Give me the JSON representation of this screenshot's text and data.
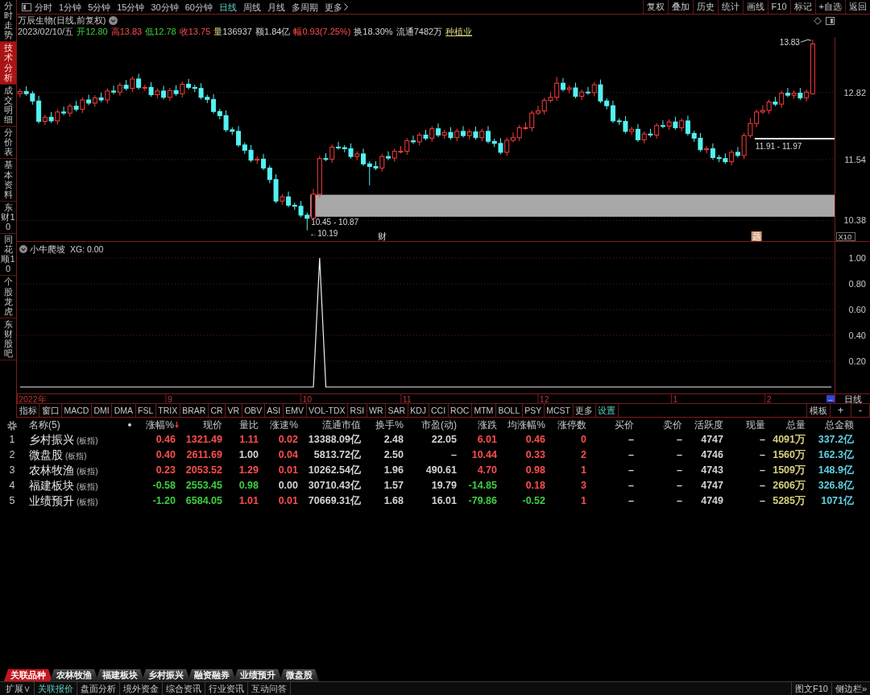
{
  "sidebar": {
    "items": [
      {
        "label": "分时走势",
        "selected": false
      },
      {
        "label": "技术分析",
        "selected": true
      },
      {
        "label": "成交明细",
        "selected": false
      },
      {
        "label": "分价表",
        "selected": false
      },
      {
        "label": "基本资料",
        "selected": false
      },
      {
        "label": "东财10",
        "selected": false
      },
      {
        "label": "同花顺10",
        "selected": false
      },
      {
        "label": "个股龙虎",
        "selected": false
      },
      {
        "label": "东财股吧",
        "selected": false
      }
    ]
  },
  "toolbar": {
    "periods": [
      {
        "label": "分时",
        "selected": false
      },
      {
        "label": "1分钟",
        "selected": false
      },
      {
        "label": "5分钟",
        "selected": false
      },
      {
        "label": "15分钟",
        "selected": false
      },
      {
        "label": "30分钟",
        "selected": false
      },
      {
        "label": "60分钟",
        "selected": false
      },
      {
        "label": "日线",
        "selected": true
      },
      {
        "label": "周线",
        "selected": false
      },
      {
        "label": "月线",
        "selected": false
      },
      {
        "label": "多周期",
        "selected": false
      }
    ],
    "more": "更多",
    "buttons": [
      "复权",
      "叠加",
      "历史",
      "统计",
      "画线",
      "F10",
      "标记",
      "+自选",
      "返回"
    ]
  },
  "quote_header": {
    "title": "万辰生物(日线,前复权)",
    "date": "2023/02/10/五",
    "fields": [
      {
        "label": "开",
        "value": "12.80",
        "color": "#3fcf3f",
        "label_highlight": false
      },
      {
        "label": "高",
        "value": "13.83",
        "color": "#ff4d4d",
        "label_highlight": false
      },
      {
        "label": "低",
        "value": "12.78",
        "color": "#3fcf3f",
        "label_highlight": false
      },
      {
        "label": "收",
        "value": "13.75",
        "color": "#ff4d4d",
        "label_highlight": false
      },
      {
        "label": "量",
        "value": "136937",
        "color": "#d4d4d4",
        "label_highlight": true
      },
      {
        "label": "额",
        "value": "1.84亿",
        "color": "#d4d4d4",
        "label_highlight": false
      },
      {
        "label": "幅",
        "value": "0.93(7.25%)",
        "color": "#ff4d4d",
        "label_highlight": false
      },
      {
        "label": "换",
        "value": "18.30%",
        "color": "#d4d4d4",
        "label_highlight": false
      },
      {
        "label": "流通",
        "value": "7482万",
        "color": "#d4d4d4",
        "label_highlight": false
      }
    ],
    "industry": "种植业"
  },
  "price_chart": {
    "chart_data": {
      "type": "candlestick",
      "categories": [
        null,
        null,
        null,
        null,
        null,
        null,
        null,
        null,
        null,
        null,
        null,
        null,
        null,
        null,
        null,
        null,
        null,
        null,
        null,
        null,
        null,
        null,
        null,
        null,
        null,
        null,
        null,
        null,
        null,
        null,
        null,
        null,
        null,
        null,
        null,
        null,
        null,
        null,
        null,
        null,
        null,
        null,
        null,
        null,
        null,
        null,
        null,
        null,
        null,
        null,
        null,
        null,
        null,
        null,
        null,
        null,
        null,
        null,
        null,
        null,
        null,
        null,
        null,
        null,
        null,
        null,
        null,
        null,
        null,
        null,
        null,
        null,
        null,
        null,
        null,
        null,
        null,
        null,
        null,
        null,
        null,
        null,
        null,
        null,
        null,
        null,
        null,
        null,
        null,
        null,
        null,
        null,
        null,
        null,
        null,
        null,
        null,
        null,
        null,
        null,
        null,
        null,
        null,
        null,
        null,
        null,
        null,
        null,
        null,
        null,
        null,
        null,
        null,
        null,
        null,
        null,
        null,
        null,
        null,
        null,
        null,
        null,
        null,
        null,
        null,
        null,
        null,
        null,
        null,
        null,
        null
      ],
      "ohlc": [
        [
          12.8,
          12.89,
          12.73,
          12.84
        ],
        [
          12.84,
          12.94,
          12.76,
          12.8
        ],
        [
          12.8,
          12.85,
          12.59,
          12.66
        ],
        [
          12.66,
          12.76,
          12.23,
          12.27
        ],
        [
          12.27,
          12.4,
          12.2,
          12.35
        ],
        [
          12.35,
          12.45,
          12.24,
          12.28
        ],
        [
          12.28,
          12.5,
          12.21,
          12.45
        ],
        [
          12.45,
          12.55,
          12.39,
          12.43
        ],
        [
          12.43,
          12.61,
          12.36,
          12.56
        ],
        [
          12.56,
          12.66,
          12.46,
          12.5
        ],
        [
          12.5,
          12.73,
          12.43,
          12.68
        ],
        [
          12.68,
          12.78,
          12.58,
          12.62
        ],
        [
          12.62,
          12.77,
          12.55,
          12.72
        ],
        [
          12.72,
          12.82,
          12.64,
          12.68
        ],
        [
          12.68,
          12.9,
          12.61,
          12.85
        ],
        [
          12.85,
          12.95,
          12.79,
          12.83
        ],
        [
          12.83,
          13.01,
          12.76,
          12.96
        ],
        [
          12.96,
          13.06,
          12.86,
          12.9
        ],
        [
          12.9,
          13.13,
          12.83,
          13.08
        ],
        [
          13.08,
          13.18,
          12.88,
          12.92
        ],
        [
          12.92,
          12.97,
          12.85,
          12.92
        ],
        [
          12.92,
          13.02,
          12.74,
          12.78
        ],
        [
          12.78,
          12.9,
          12.71,
          12.85
        ],
        [
          12.85,
          12.95,
          12.69,
          12.73
        ],
        [
          12.73,
          12.91,
          12.66,
          12.86
        ],
        [
          12.86,
          12.96,
          12.76,
          12.8
        ],
        [
          12.8,
          13.03,
          12.73,
          12.98
        ],
        [
          12.98,
          13.08,
          12.88,
          12.92
        ],
        [
          12.92,
          12.97,
          12.83,
          12.9
        ],
        [
          12.9,
          13.0,
          12.69,
          12.73
        ],
        [
          12.73,
          12.78,
          12.62,
          12.69
        ],
        [
          12.69,
          12.79,
          12.42,
          12.46
        ],
        [
          12.46,
          12.51,
          12.31,
          12.38
        ],
        [
          12.38,
          12.48,
          12.07,
          12.11
        ],
        [
          12.11,
          12.16,
          12.01,
          12.08
        ],
        [
          12.08,
          12.18,
          11.78,
          11.82
        ],
        [
          11.82,
          11.87,
          11.65,
          11.72
        ],
        [
          11.72,
          11.82,
          11.49,
          11.53
        ],
        [
          11.53,
          11.6,
          11.46,
          11.55
        ],
        [
          11.55,
          11.65,
          11.34,
          11.38
        ],
        [
          11.38,
          11.43,
          11.09,
          11.16
        ],
        [
          11.16,
          11.26,
          10.71,
          10.75
        ],
        [
          10.75,
          10.88,
          10.68,
          10.83
        ],
        [
          10.83,
          10.93,
          10.63,
          10.67
        ],
        [
          10.67,
          10.72,
          10.58,
          10.65
        ],
        [
          10.65,
          10.75,
          10.44,
          10.48
        ],
        [
          10.48,
          10.53,
          10.19,
          10.42
        ],
        [
          10.42,
          10.98,
          10.38,
          10.88
        ],
        [
          10.88,
          11.61,
          10.81,
          11.56
        ],
        [
          11.56,
          11.66,
          11.51,
          11.55
        ],
        [
          11.55,
          11.83,
          11.48,
          11.78
        ],
        [
          11.78,
          11.88,
          11.73,
          11.77
        ],
        [
          11.77,
          11.82,
          11.68,
          11.75
        ],
        [
          11.75,
          11.85,
          11.56,
          11.6
        ],
        [
          11.6,
          11.7,
          11.53,
          11.65
        ],
        [
          11.65,
          11.75,
          11.42,
          11.46
        ],
        [
          11.46,
          11.51,
          11.05,
          11.41
        ],
        [
          11.41,
          11.51,
          11.34,
          11.38
        ],
        [
          11.38,
          11.65,
          11.31,
          11.6
        ],
        [
          11.6,
          11.7,
          11.53,
          11.57
        ],
        [
          11.57,
          11.75,
          11.5,
          11.7
        ],
        [
          11.7,
          11.8,
          11.66,
          11.7
        ],
        [
          11.7,
          11.95,
          11.63,
          11.9
        ],
        [
          11.9,
          12.0,
          11.84,
          11.88
        ],
        [
          11.88,
          12.06,
          11.81,
          12.01
        ],
        [
          12.01,
          12.11,
          11.91,
          11.95
        ],
        [
          11.95,
          12.18,
          11.88,
          12.13
        ],
        [
          12.13,
          12.23,
          11.97,
          12.01
        ],
        [
          12.01,
          12.11,
          11.94,
          12.06
        ],
        [
          12.06,
          12.16,
          11.92,
          11.96
        ],
        [
          11.96,
          12.13,
          11.89,
          12.08
        ],
        [
          12.08,
          12.18,
          11.96,
          12.0
        ],
        [
          12.0,
          12.12,
          11.93,
          12.07
        ],
        [
          12.07,
          12.17,
          11.92,
          11.96
        ],
        [
          11.96,
          12.13,
          11.89,
          12.08
        ],
        [
          12.08,
          12.18,
          11.85,
          11.89
        ],
        [
          11.89,
          11.94,
          11.78,
          11.85
        ],
        [
          11.85,
          11.95,
          11.64,
          11.68
        ],
        [
          11.68,
          11.96,
          11.61,
          11.91
        ],
        [
          11.91,
          12.06,
          11.87,
          11.96
        ],
        [
          11.96,
          12.2,
          11.89,
          12.15
        ],
        [
          12.15,
          12.25,
          12.11,
          12.15
        ],
        [
          12.15,
          12.48,
          12.08,
          12.43
        ],
        [
          12.43,
          12.57,
          12.39,
          12.47
        ],
        [
          12.47,
          12.72,
          12.4,
          12.67
        ],
        [
          12.67,
          12.83,
          12.63,
          12.73
        ],
        [
          12.73,
          13.12,
          12.66,
          13.0
        ],
        [
          13.0,
          13.1,
          12.84,
          12.88
        ],
        [
          12.88,
          12.96,
          12.81,
          12.91
        ],
        [
          12.91,
          13.01,
          12.71,
          12.75
        ],
        [
          12.75,
          12.88,
          12.68,
          12.83
        ],
        [
          12.83,
          12.93,
          12.78,
          12.82
        ],
        [
          12.82,
          13.02,
          12.75,
          12.97
        ],
        [
          12.97,
          13.07,
          12.62,
          12.66
        ],
        [
          12.66,
          12.71,
          12.5,
          12.57
        ],
        [
          12.57,
          12.67,
          12.24,
          12.28
        ],
        [
          12.28,
          12.33,
          12.2,
          12.27
        ],
        [
          12.27,
          12.37,
          12.04,
          12.08
        ],
        [
          12.08,
          12.17,
          12.01,
          12.12
        ],
        [
          12.12,
          12.22,
          11.88,
          11.92
        ],
        [
          11.92,
          12.08,
          11.85,
          12.03
        ],
        [
          12.03,
          12.13,
          11.97,
          12.01
        ],
        [
          12.01,
          12.24,
          11.94,
          12.19
        ],
        [
          12.19,
          12.29,
          12.14,
          12.18
        ],
        [
          12.18,
          12.31,
          12.11,
          12.26
        ],
        [
          12.26,
          12.36,
          12.11,
          12.15
        ],
        [
          12.15,
          12.33,
          12.08,
          12.28
        ],
        [
          12.28,
          12.38,
          12.0,
          12.04
        ],
        [
          12.04,
          12.09,
          11.88,
          11.95
        ],
        [
          11.95,
          12.05,
          11.69,
          11.73
        ],
        [
          11.73,
          11.8,
          11.66,
          11.75
        ],
        [
          11.75,
          11.85,
          11.54,
          11.58
        ],
        [
          11.58,
          11.63,
          11.49,
          11.56
        ],
        [
          11.56,
          11.66,
          11.46,
          11.5
        ],
        [
          11.5,
          11.73,
          11.43,
          11.68
        ],
        [
          11.68,
          11.78,
          11.58,
          11.62
        ],
        [
          11.62,
          12.05,
          11.55,
          12.0
        ],
        [
          12.0,
          12.33,
          11.96,
          12.23
        ],
        [
          12.23,
          12.5,
          12.16,
          12.45
        ],
        [
          12.45,
          12.58,
          12.41,
          12.48
        ],
        [
          12.48,
          12.69,
          12.41,
          12.64
        ],
        [
          12.64,
          12.74,
          12.56,
          12.6
        ],
        [
          12.6,
          12.86,
          12.53,
          12.81
        ],
        [
          12.81,
          12.91,
          12.73,
          12.77
        ],
        [
          12.77,
          12.86,
          12.7,
          12.81
        ],
        [
          12.81,
          12.91,
          12.68,
          12.72
        ],
        [
          12.72,
          12.88,
          12.65,
          12.83
        ],
        [
          12.8,
          13.83,
          12.78,
          13.75
        ],
        null,
        null,
        null
      ],
      "ylim": [
        9.97,
        13.88
      ],
      "yticks": [
        {
          "value": 12.82,
          "label": "12.82"
        },
        {
          "value": 11.54,
          "label": "11.54"
        },
        {
          "value": 10.38,
          "label": "10.38"
        }
      ],
      "grid": true,
      "bands": [
        {
          "axis": "y",
          "from": 10.45,
          "to": 10.87,
          "label": "10.45 - 10.87",
          "color": "#a8a8a8"
        }
      ]
    },
    "overlays": [
      {
        "kind": "level_line",
        "label": "11.91 - 11.97"
      },
      {
        "kind": "high_point",
        "label": "13.83"
      },
      {
        "kind": "low_point",
        "label": "←10.19"
      }
    ],
    "event_marks": [
      {
        "text": "财",
        "boxed": false
      },
      {
        "text": "题",
        "boxed": true
      }
    ],
    "zoom_label": "X10"
  },
  "indicator": {
    "legend": "XG: 0.00",
    "scroll_button": "--",
    "period_label": "日线",
    "chart_data": {
      "type": "line",
      "title": "小牛爬坡",
      "categories": [
        null,
        null,
        "2022年",
        null,
        null,
        null,
        null,
        null,
        null,
        null,
        null,
        null,
        null,
        null,
        null,
        null,
        null,
        null,
        null,
        null,
        null,
        null,
        null,
        null,
        "9",
        null,
        null,
        null,
        null,
        null,
        null,
        null,
        null,
        null,
        null,
        null,
        null,
        null,
        null,
        null,
        null,
        null,
        null,
        null,
        null,
        null,
        "10",
        null,
        null,
        null,
        null,
        null,
        null,
        null,
        null,
        null,
        null,
        null,
        null,
        null,
        null,
        null,
        "11",
        null,
        null,
        null,
        null,
        null,
        null,
        null,
        null,
        null,
        null,
        null,
        null,
        null,
        null,
        null,
        null,
        null,
        null,
        null,
        null,
        null,
        "12",
        null,
        null,
        null,
        null,
        null,
        null,
        null,
        null,
        null,
        null,
        null,
        null,
        null,
        null,
        null,
        null,
        null,
        null,
        null,
        null,
        "1",
        null,
        null,
        null,
        null,
        null,
        null,
        null,
        null,
        null,
        null,
        null,
        null,
        null,
        null,
        "2",
        null,
        null,
        null,
        null,
        null,
        null,
        null,
        null,
        null,
        null
      ],
      "values": [
        0,
        0,
        0,
        0,
        0,
        0,
        0,
        0,
        0,
        0,
        0,
        0,
        0,
        0,
        0,
        0,
        0,
        0,
        0,
        0,
        0,
        0,
        0,
        0,
        0,
        0,
        0,
        0,
        0,
        0,
        0,
        0,
        0,
        0,
        0,
        0,
        0,
        0,
        0,
        0,
        0,
        0,
        0,
        0,
        0,
        0,
        0,
        0,
        1,
        0,
        0,
        0,
        0,
        0,
        0,
        0,
        0,
        0,
        0,
        0,
        0,
        0,
        0,
        0,
        0,
        0,
        0,
        0,
        0,
        0,
        0,
        0,
        0,
        0,
        0,
        0,
        0,
        0,
        0,
        0,
        0,
        0,
        0,
        0,
        0,
        0,
        0,
        0,
        0,
        0,
        0,
        0,
        0,
        0,
        0,
        0,
        0,
        0,
        0,
        0,
        0,
        0,
        0,
        0,
        0,
        0,
        0,
        0,
        0,
        0,
        0,
        0,
        0,
        0,
        0,
        0,
        0,
        0,
        0,
        0,
        0,
        0,
        0,
        0,
        0,
        0,
        0,
        0,
        0,
        0,
        0
      ],
      "ylim": [
        -0.125,
        1.125
      ],
      "yticks": [
        {
          "value": 1,
          "label": "1.00"
        },
        {
          "value": 0.8,
          "label": "0.80"
        },
        {
          "value": 0.6,
          "label": "0.60"
        },
        {
          "value": 0.4,
          "label": "0.40"
        },
        {
          "value": 0.2,
          "label": "0.20"
        }
      ],
      "grid": true
    }
  },
  "indicator_tabs": {
    "tabs": [
      "指标",
      "窗口",
      "MACD",
      "DMI",
      "DMA",
      "FSL",
      "TRIX",
      "BRAR",
      "CR",
      "VR",
      "OBV",
      "ASI",
      "EMV",
      "VOL-TDX",
      "RSI",
      "WR",
      "SAR",
      "KDJ",
      "CCI",
      "ROC",
      "MTM",
      "BOLL",
      "PSY",
      "MCST",
      "更多"
    ],
    "settings": "设置",
    "template": "模板",
    "zoom_buttons": [
      "+",
      "-"
    ]
  },
  "table": {
    "name_header": "名称(5)",
    "columns": [
      {
        "label": "涨幅%",
        "kind": "trend",
        "sorted": true
      },
      {
        "label": "现价",
        "kind": "trend",
        "sorted": false
      },
      {
        "label": "量比",
        "kind": "trend",
        "sorted": false
      },
      {
        "label": "涨速%",
        "kind": "trend",
        "sorted": false
      },
      {
        "label": "流通市值",
        "kind": "plain",
        "sorted": false
      },
      {
        "label": "换手%",
        "kind": "plain",
        "sorted": false
      },
      {
        "label": "市盈(动)",
        "kind": "plain",
        "sorted": false
      },
      {
        "label": "涨跌",
        "kind": "trend",
        "sorted": false
      },
      {
        "label": "均涨幅%",
        "kind": "trend",
        "sorted": false
      },
      {
        "label": "涨停数",
        "kind": "trend",
        "sorted": false
      },
      {
        "label": "买价",
        "kind": "plain",
        "sorted": false
      },
      {
        "label": "卖价",
        "kind": "plain",
        "sorted": false
      },
      {
        "label": "活跃度",
        "kind": "plain",
        "sorted": false
      },
      {
        "label": "现量",
        "kind": "plain",
        "sorted": false
      },
      {
        "label": "总量",
        "kind": "volume",
        "sorted": false
      },
      {
        "label": "总金额",
        "kind": "amount",
        "sorted": false
      }
    ],
    "rows": [
      {
        "index": "1",
        "name": "乡村振兴",
        "tag": "(板指)",
        "cells": [
          {
            "text": "0.46",
            "color": "#ff4d4d"
          },
          {
            "text": "1321.49",
            "color": "#ff4d4d"
          },
          {
            "text": "1.11",
            "color": "#ff4d4d"
          },
          {
            "text": "0.02",
            "color": "#ff4d4d"
          },
          {
            "text": "13388.09亿"
          },
          {
            "text": "2.48"
          },
          {
            "text": "22.05"
          },
          {
            "text": "6.01",
            "color": "#ff4d4d"
          },
          {
            "text": "0.46",
            "color": "#ff4d4d"
          },
          {
            "text": "0",
            "color": "#ff4d4d"
          },
          {
            "text": "–"
          },
          {
            "text": "–"
          },
          {
            "text": "4747"
          },
          {
            "text": "–"
          },
          {
            "text": "4091万"
          },
          {
            "text": "337.2亿"
          }
        ]
      },
      {
        "index": "2",
        "name": "微盘股",
        "tag": "(板指)",
        "cells": [
          {
            "text": "0.40",
            "color": "#ff4d4d"
          },
          {
            "text": "2611.69",
            "color": "#ff4d4d"
          },
          {
            "text": "1.00",
            "color": "#d4d4d4"
          },
          {
            "text": "0.04",
            "color": "#ff4d4d"
          },
          {
            "text": "5813.72亿"
          },
          {
            "text": "2.50"
          },
          {
            "text": "–"
          },
          {
            "text": "10.44",
            "color": "#ff4d4d"
          },
          {
            "text": "0.33",
            "color": "#ff4d4d"
          },
          {
            "text": "2",
            "color": "#ff4d4d"
          },
          {
            "text": "–"
          },
          {
            "text": "–"
          },
          {
            "text": "4746"
          },
          {
            "text": "–"
          },
          {
            "text": "1560万"
          },
          {
            "text": "162.3亿"
          }
        ]
      },
      {
        "index": "3",
        "name": "农林牧渔",
        "tag": "(板指)",
        "cells": [
          {
            "text": "0.23",
            "color": "#ff4d4d"
          },
          {
            "text": "2053.52",
            "color": "#ff4d4d"
          },
          {
            "text": "1.29",
            "color": "#ff4d4d"
          },
          {
            "text": "0.01",
            "color": "#ff4d4d"
          },
          {
            "text": "10262.54亿"
          },
          {
            "text": "1.96"
          },
          {
            "text": "490.61"
          },
          {
            "text": "4.70",
            "color": "#ff4d4d"
          },
          {
            "text": "0.98",
            "color": "#ff4d4d"
          },
          {
            "text": "1",
            "color": "#ff4d4d"
          },
          {
            "text": "–"
          },
          {
            "text": "–"
          },
          {
            "text": "4743"
          },
          {
            "text": "–"
          },
          {
            "text": "1509万"
          },
          {
            "text": "148.9亿"
          }
        ]
      },
      {
        "index": "4",
        "name": "福建板块",
        "tag": "(板指)",
        "cells": [
          {
            "text": "-0.58",
            "color": "#3fcf3f"
          },
          {
            "text": "2553.45",
            "color": "#3fcf3f"
          },
          {
            "text": "0.98",
            "color": "#3fcf3f"
          },
          {
            "text": "0.00",
            "color": "#d4d4d4"
          },
          {
            "text": "30710.43亿"
          },
          {
            "text": "1.57"
          },
          {
            "text": "19.79"
          },
          {
            "text": "-14.85",
            "color": "#3fcf3f"
          },
          {
            "text": "0.18",
            "color": "#ff4d4d"
          },
          {
            "text": "3",
            "color": "#ff4d4d"
          },
          {
            "text": "–"
          },
          {
            "text": "–"
          },
          {
            "text": "4747"
          },
          {
            "text": "–"
          },
          {
            "text": "2606万"
          },
          {
            "text": "326.8亿"
          }
        ]
      },
      {
        "index": "5",
        "name": "业绩预升",
        "tag": "(板指)",
        "cells": [
          {
            "text": "-1.20",
            "color": "#3fcf3f"
          },
          {
            "text": "6584.05",
            "color": "#3fcf3f"
          },
          {
            "text": "1.01",
            "color": "#ff4d4d"
          },
          {
            "text": "0.01",
            "color": "#ff4d4d"
          },
          {
            "text": "70669.31亿"
          },
          {
            "text": "1.68"
          },
          {
            "text": "16.01"
          },
          {
            "text": "-79.86",
            "color": "#3fcf3f"
          },
          {
            "text": "-0.52",
            "color": "#3fcf3f"
          },
          {
            "text": "1",
            "color": "#ff4d4d"
          },
          {
            "text": "–"
          },
          {
            "text": "–"
          },
          {
            "text": "4749"
          },
          {
            "text": "–"
          },
          {
            "text": "5285万"
          },
          {
            "text": "1071亿"
          }
        ]
      }
    ]
  },
  "bottom_tabs": [
    {
      "label": "关联品种",
      "selected": true
    },
    {
      "label": "农林牧渔",
      "selected": false
    },
    {
      "label": "福建板块",
      "selected": false
    },
    {
      "label": "乡村振兴",
      "selected": false
    },
    {
      "label": "融资融券",
      "selected": false
    },
    {
      "label": "业绩预升",
      "selected": false
    },
    {
      "label": "微盘股",
      "selected": false
    }
  ],
  "bottom_bar": {
    "items": [
      {
        "label": "扩展∨",
        "selected": false
      },
      {
        "label": "关联报价",
        "selected": true
      },
      {
        "label": "盘面分析",
        "selected": false
      },
      {
        "label": "境外资金",
        "selected": false
      },
      {
        "label": "综合资讯",
        "selected": false
      },
      {
        "label": "行业资讯",
        "selected": false
      },
      {
        "label": "互动问答",
        "selected": false
      }
    ],
    "right_items": [
      "图文F10",
      "侧边栏»"
    ]
  }
}
